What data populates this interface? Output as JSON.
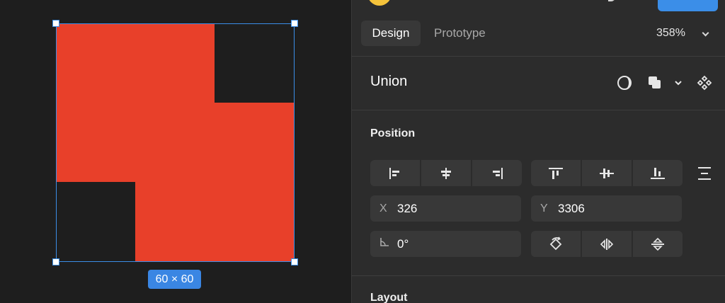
{
  "canvas": {
    "shape_color": "#e8402a",
    "hole_color": "#1e1e1e",
    "selection_color": "#3b8ee8",
    "size_label": "60 × 60"
  },
  "panel": {
    "tabs": [
      {
        "label": "Design",
        "active": true
      },
      {
        "label": "Prototype",
        "active": false
      }
    ],
    "zoom": "358%",
    "layer": {
      "title": "Union",
      "icons": [
        "mask-icon",
        "boolean-union-icon",
        "chevron-down-icon",
        "component-icon"
      ]
    },
    "position": {
      "title": "Position",
      "align_horizontal": [
        "align-left-icon",
        "align-horizontal-center-icon",
        "align-right-icon"
      ],
      "align_vertical": [
        "align-top-icon",
        "align-vertical-center-icon",
        "align-bottom-icon"
      ],
      "x_label": "X",
      "x_value": "326",
      "y_label": "Y",
      "y_value": "3306",
      "rotation_value": "0°",
      "transform_icons": [
        "rotate-90-icon",
        "flip-horizontal-icon",
        "flip-vertical-icon"
      ]
    },
    "layout": {
      "title": "Layout"
    }
  }
}
